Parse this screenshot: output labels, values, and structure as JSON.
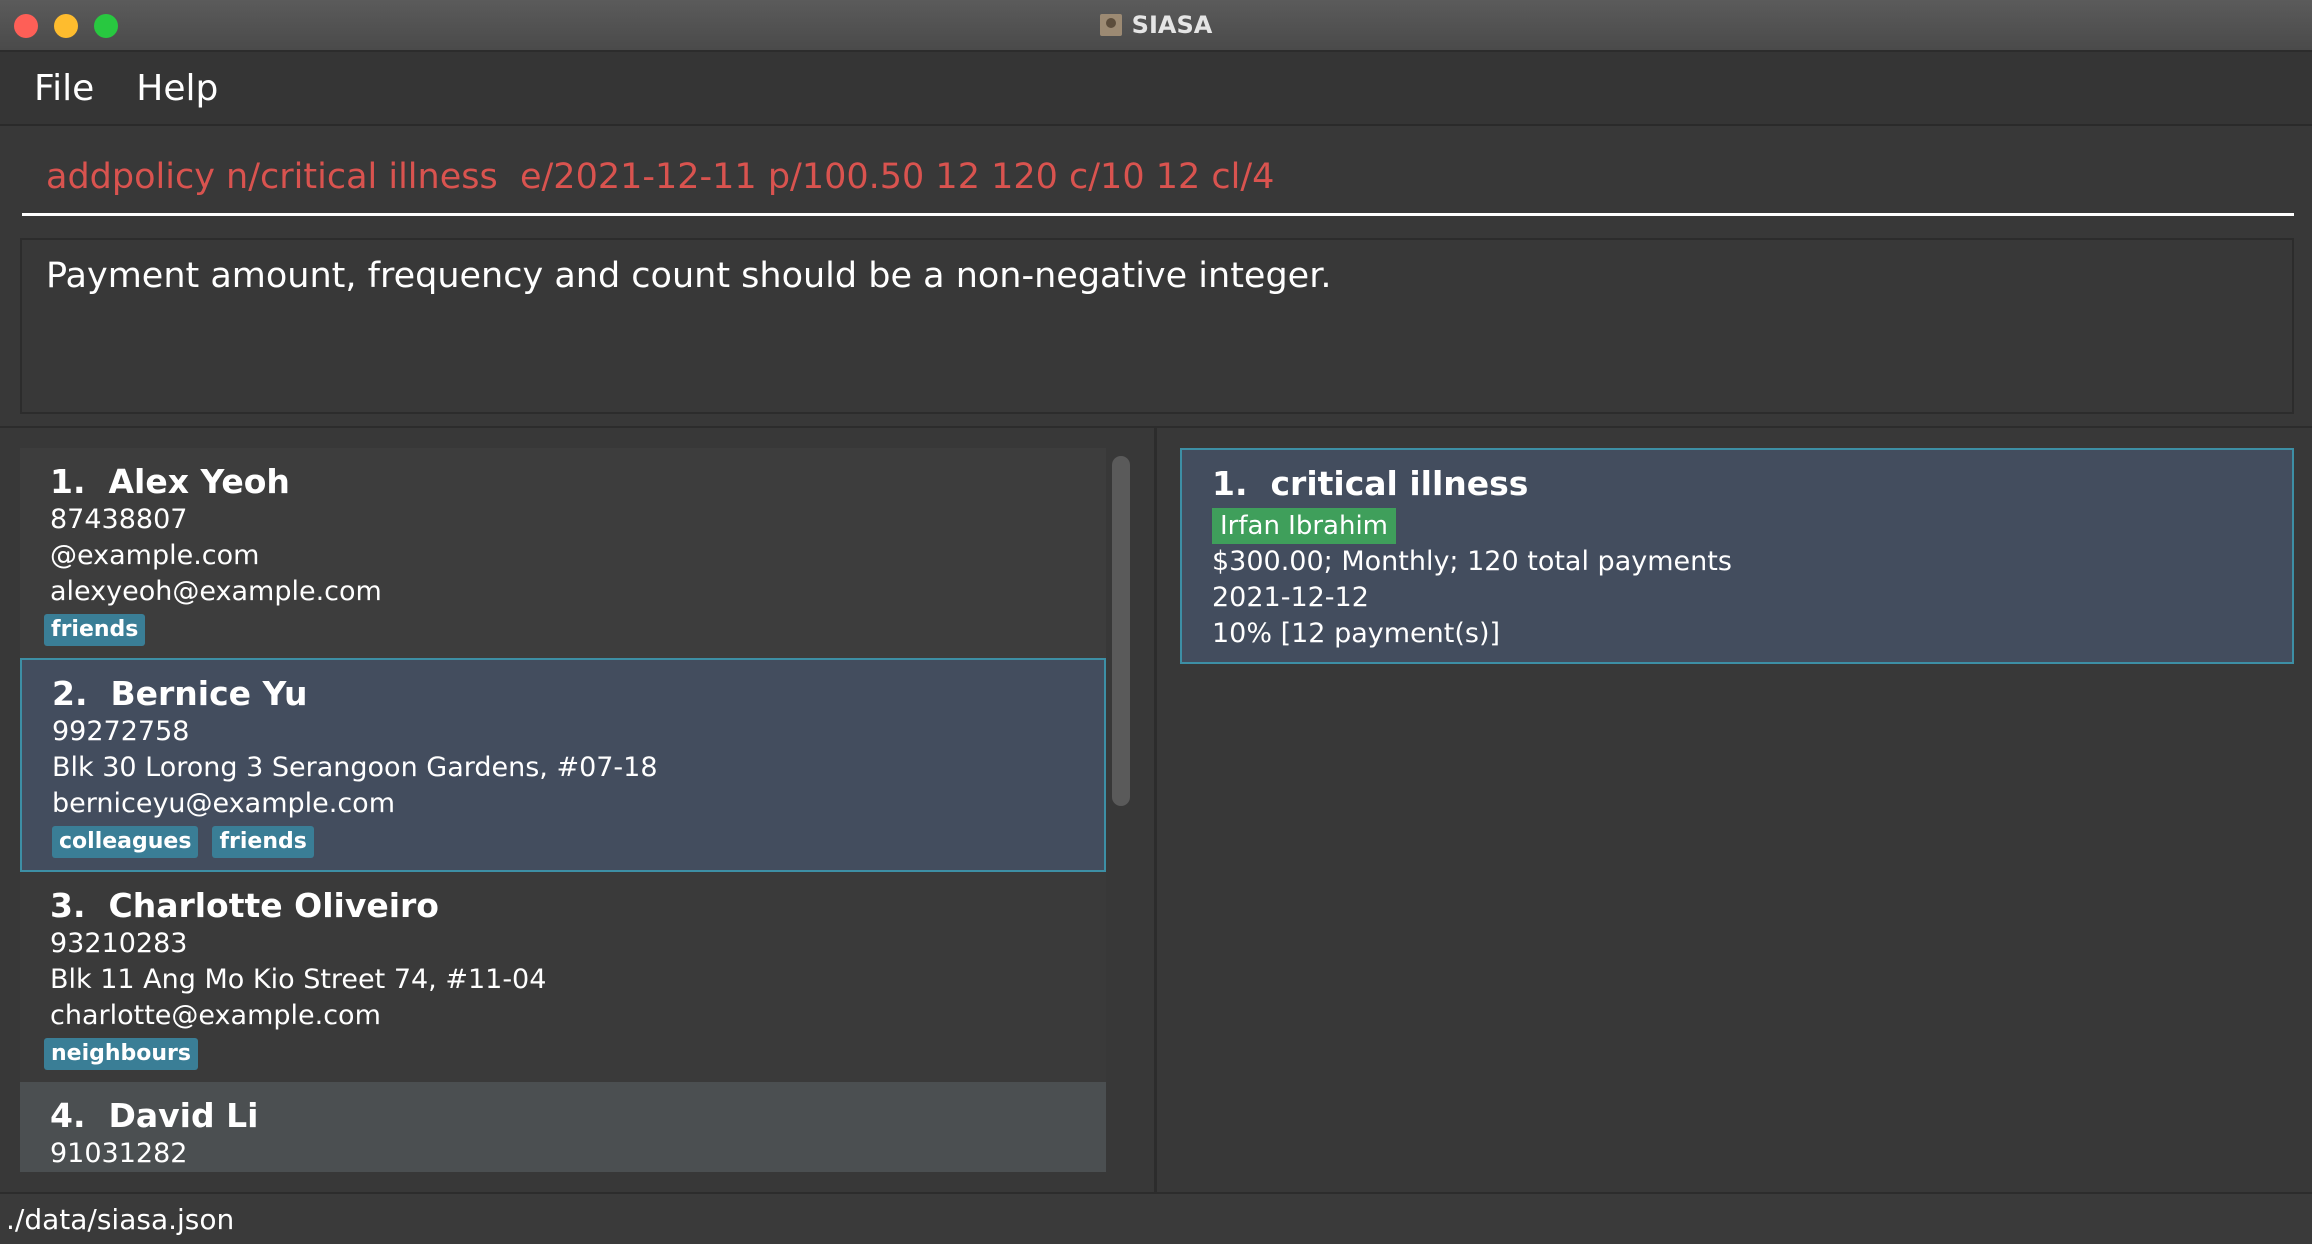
{
  "window": {
    "title": "SIASA"
  },
  "menu": {
    "file": "File",
    "help": "Help"
  },
  "command_box": {
    "value": "addpolicy n/critical illness  e/2021-12-11 p/100.50 12 120 c/10 12 cl/4"
  },
  "result_display": {
    "text": "Payment amount, frequency and count should be a non-negative integer."
  },
  "persons": [
    {
      "index": "1.",
      "name": "Alex Yeoh",
      "phone": "87438807",
      "address": "@example.com",
      "email": "alexyeoh@example.com",
      "tags": [
        "friends"
      ]
    },
    {
      "index": "2.",
      "name": "Bernice Yu",
      "phone": "99272758",
      "address": "Blk 30 Lorong 3 Serangoon Gardens, #07-18",
      "email": "berniceyu@example.com",
      "tags": [
        "colleagues",
        "friends"
      ]
    },
    {
      "index": "3.",
      "name": "Charlotte Oliveiro",
      "phone": "93210283",
      "address": "Blk 11 Ang Mo Kio Street 74, #11-04",
      "email": "charlotte@example.com",
      "tags": [
        "neighbours"
      ]
    },
    {
      "index": "4.",
      "name": "David Li",
      "phone": "91031282"
    }
  ],
  "policies": [
    {
      "index": "1.",
      "name": "critical illness",
      "owner": "Irfan Ibrahim",
      "payment": "$300.00; Monthly; 120 total payments",
      "expiry": "2021-12-12",
      "commission": "10% [12 payment(s)]"
    }
  ],
  "status_bar": {
    "path": "./data/siasa.json"
  },
  "colors": {
    "tag": "#3a7e96",
    "owner_tag": "#3f9f5b",
    "selected": "#434d5e",
    "selected_border": "#3d8fa5",
    "command_error": "#d9534f"
  }
}
